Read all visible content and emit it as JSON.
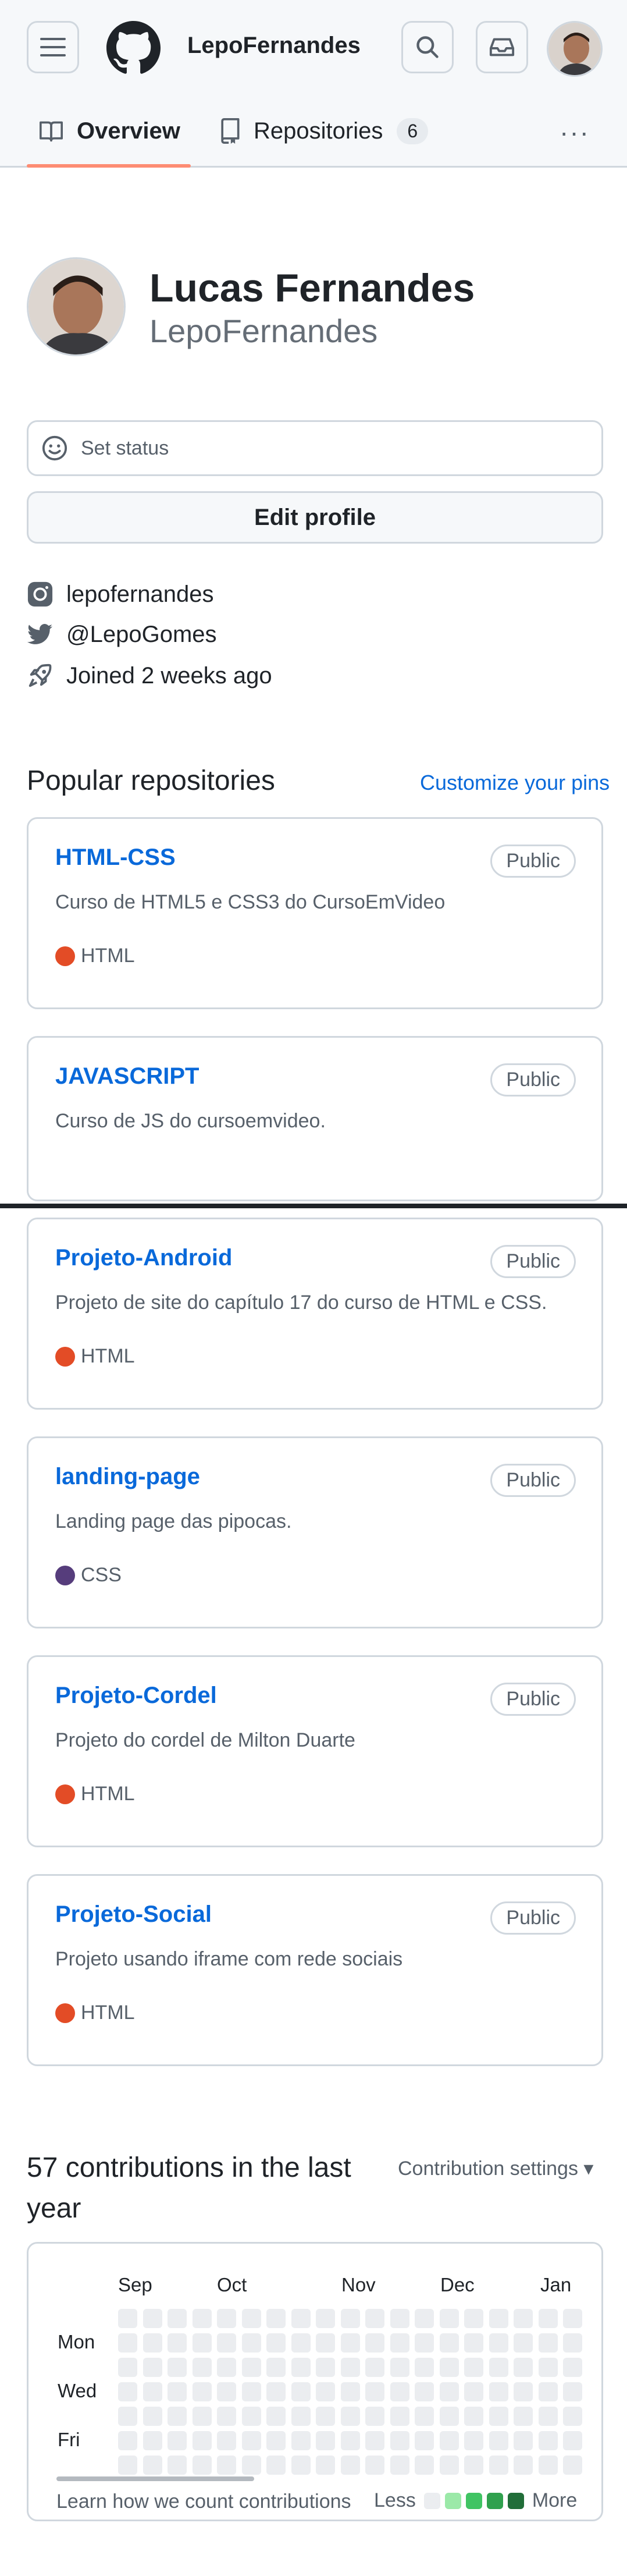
{
  "header": {
    "username": "LepoFernandes",
    "tabs": [
      {
        "label": "Overview",
        "icon": "book-icon",
        "active": true
      },
      {
        "label": "Repositories",
        "icon": "repo-icon",
        "count": "6"
      }
    ],
    "colors": {
      "accent_underline": "#fd8c73",
      "link": "#0969da"
    }
  },
  "profile": {
    "full_name": "Lucas Fernandes",
    "login": "LepoFernandes",
    "status_label": "Set status",
    "edit_label": "Edit profile",
    "instagram": "lepofernandes",
    "twitter": "@LepoGomes",
    "joined": "Joined 2 weeks ago"
  },
  "popular": {
    "title": "Popular repositories",
    "customize_label": "Customize your pins",
    "repos": [
      {
        "name": "HTML-CSS",
        "visibility": "Public",
        "description": "Curso de HTML5 e CSS3 do CursoEmVideo",
        "language": "HTML",
        "lang_color": "#e34c26"
      },
      {
        "name": "JAVASCRIPT",
        "visibility": "Public",
        "description": "Curso de JS do cursoemvideo.",
        "language": "",
        "lang_color": ""
      },
      {
        "name": "Projeto-Android",
        "visibility": "Public",
        "description": "Projeto de site do capítulo 17 do curso de HTML e CSS.",
        "language": "HTML",
        "lang_color": "#e34c26"
      },
      {
        "name": "landing-page",
        "visibility": "Public",
        "description": "Landing page das pipocas.",
        "language": "CSS",
        "lang_color": "#563d7c"
      },
      {
        "name": "Projeto-Cordel",
        "visibility": "Public",
        "description": "Projeto do cordel de Milton Duarte",
        "language": "HTML",
        "lang_color": "#e34c26"
      },
      {
        "name": "Projeto-Social",
        "visibility": "Public",
        "description": "Projeto usando iframe com rede sociais",
        "language": "HTML",
        "lang_color": "#e34c26"
      }
    ]
  },
  "contributions": {
    "title": "57 contributions in the last year",
    "settings_label": "Contribution settings ▾",
    "months": [
      "Sep",
      "Oct",
      "Nov",
      "Dec",
      "Jan"
    ],
    "day_labels": [
      "Mon",
      "Wed",
      "Fri"
    ],
    "learn_label": "Learn how we count contributions",
    "less_label": "Less",
    "more_label": "More",
    "legend_colors": [
      "#ebedf0",
      "#9be9a8",
      "#40c463",
      "#30a14e",
      "#216e39"
    ]
  }
}
